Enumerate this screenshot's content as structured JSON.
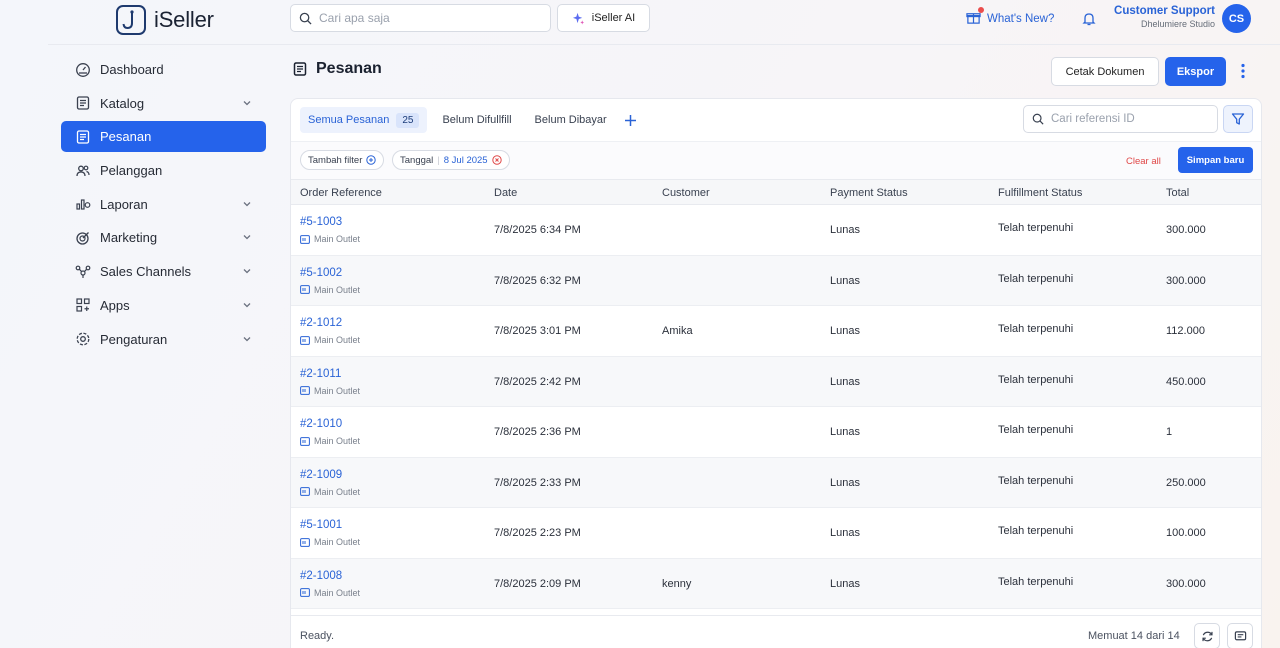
{
  "topbar": {
    "brand": "iSeller",
    "search_placeholder": "Cari apa saja",
    "ai_label": "iSeller AI",
    "whats_new": "What's New?",
    "support_name": "Customer Support",
    "support_org": "Dhelumiere Studio",
    "avatar_initials": "CS"
  },
  "sidebar": {
    "items": [
      {
        "label": "Dashboard",
        "icon": "dashboard-icon",
        "expandable": false
      },
      {
        "label": "Katalog",
        "icon": "catalog-icon",
        "expandable": true
      },
      {
        "label": "Pesanan",
        "icon": "orders-icon",
        "expandable": false,
        "active": true
      },
      {
        "label": "Pelanggan",
        "icon": "customers-icon",
        "expandable": false
      },
      {
        "label": "Laporan",
        "icon": "reports-icon",
        "expandable": true
      },
      {
        "label": "Marketing",
        "icon": "marketing-icon",
        "expandable": true
      },
      {
        "label": "Sales Channels",
        "icon": "channels-icon",
        "expandable": true
      },
      {
        "label": "Apps",
        "icon": "apps-icon",
        "expandable": true
      },
      {
        "label": "Pengaturan",
        "icon": "settings-icon",
        "expandable": true
      }
    ]
  },
  "main": {
    "title": "Pesanan",
    "print_label": "Cetak Dokumen",
    "export_label": "Ekspor",
    "tabs": [
      {
        "label": "Semua Pesanan",
        "count": "25",
        "active": true
      },
      {
        "label": "Belum Difullfill"
      },
      {
        "label": "Belum Dibayar"
      }
    ],
    "ref_search_placeholder": "Cari referensi ID",
    "filters": {
      "add_filter": "Tambah filter",
      "date_label": "Tanggal",
      "date_value": "8 Jul 2025",
      "clear_all": "Clear all",
      "save_new": "Simpan baru"
    },
    "columns": [
      "Order Reference",
      "Date",
      "Customer",
      "Payment Status",
      "Fulfillment Status",
      "Total"
    ],
    "rows": [
      {
        "ref": "#5-1003",
        "outlet": "Main Outlet",
        "date": "7/8/2025 6:34 PM",
        "customer": "",
        "payment": "Lunas",
        "fulfillment": "Telah terpenuhi",
        "total": "300.000"
      },
      {
        "ref": "#5-1002",
        "outlet": "Main Outlet",
        "date": "7/8/2025 6:32 PM",
        "customer": "",
        "payment": "Lunas",
        "fulfillment": "Telah terpenuhi",
        "total": "300.000"
      },
      {
        "ref": "#2-1012",
        "outlet": "Main Outlet",
        "date": "7/8/2025 3:01 PM",
        "customer": "Amika",
        "payment": "Lunas",
        "fulfillment": "Telah terpenuhi",
        "total": "112.000"
      },
      {
        "ref": "#2-1011",
        "outlet": "Main Outlet",
        "date": "7/8/2025 2:42 PM",
        "customer": "",
        "payment": "Lunas",
        "fulfillment": "Telah terpenuhi",
        "total": "450.000"
      },
      {
        "ref": "#2-1010",
        "outlet": "Main Outlet",
        "date": "7/8/2025 2:36 PM",
        "customer": "",
        "payment": "Lunas",
        "fulfillment": "Telah terpenuhi",
        "total": "1"
      },
      {
        "ref": "#2-1009",
        "outlet": "Main Outlet",
        "date": "7/8/2025 2:33 PM",
        "customer": "",
        "payment": "Lunas",
        "fulfillment": "Telah terpenuhi",
        "total": "250.000"
      },
      {
        "ref": "#5-1001",
        "outlet": "Main Outlet",
        "date": "7/8/2025 2:23 PM",
        "customer": "",
        "payment": "Lunas",
        "fulfillment": "Telah terpenuhi",
        "total": "100.000"
      },
      {
        "ref": "#2-1008",
        "outlet": "Main Outlet",
        "date": "7/8/2025 2:09 PM",
        "customer": "kenny",
        "payment": "Lunas",
        "fulfillment": "Telah terpenuhi",
        "total": "300.000"
      }
    ],
    "footer": {
      "status": "Ready.",
      "loaded": "Memuat 14 dari 14"
    }
  },
  "colors": {
    "accent": "#2563eb",
    "link": "#2a63d6",
    "danger": "#e04848"
  }
}
